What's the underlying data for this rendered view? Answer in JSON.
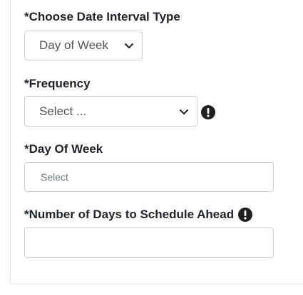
{
  "form": {
    "interval_type": {
      "label": "*Choose Date Interval Type",
      "value": "Day of Week"
    },
    "frequency": {
      "label": "*Frequency",
      "value": "Select ...",
      "icon": "exclamation-circle-icon"
    },
    "day_of_week": {
      "label": "*Day Of Week",
      "placeholder": "Select"
    },
    "days_ahead": {
      "label": "*Number of Days to Schedule Ahead",
      "value": "",
      "icon": "exclamation-circle-icon"
    }
  }
}
